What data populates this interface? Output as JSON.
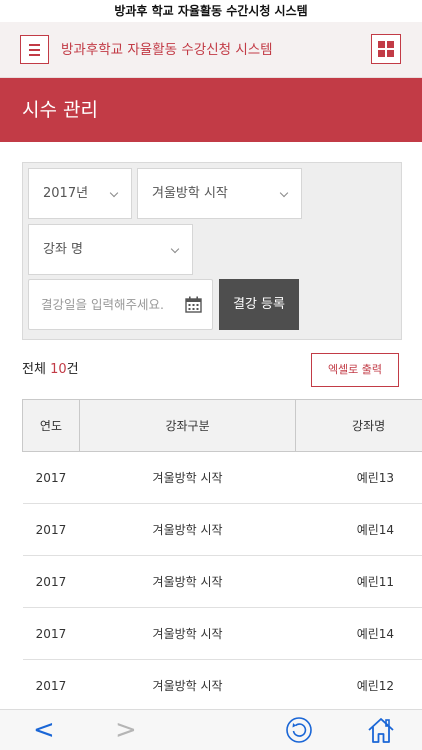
{
  "window": {
    "title": "방과후 학교 자율활동 수간시청 시스템"
  },
  "header": {
    "app_title": "방과후학교 자율활동 수강신청 시스템",
    "menu_icon": "hamburger-icon",
    "apps_icon": "grid-icon"
  },
  "page": {
    "heading": "시수 관리"
  },
  "filters": {
    "year": "2017년",
    "type": "겨울방학 시작",
    "course": "강좌 명",
    "date_placeholder": "결강일을 입력해주세요.",
    "register_label": "결강 등록"
  },
  "summary": {
    "prefix": "전체 ",
    "count": "10",
    "suffix": "건",
    "excel_label": "엑셀로 출력"
  },
  "table": {
    "headers": [
      "연도",
      "강좌구분",
      "강좌명"
    ],
    "rows": [
      [
        "2017",
        "겨울방학 시작",
        "예린13"
      ],
      [
        "2017",
        "겨울방학 시작",
        "예린14"
      ],
      [
        "2017",
        "겨울방학 시작",
        "예린11"
      ],
      [
        "2017",
        "겨울방학 시작",
        "예린14"
      ],
      [
        "2017",
        "겨울방학 시작",
        "예린12"
      ]
    ]
  },
  "nav": {
    "back": "<",
    "forward": ">",
    "refresh_icon": "refresh-icon",
    "home_icon": "home-icon"
  },
  "colors": {
    "accent": "#c23b46",
    "button_dark": "#4e4e4e",
    "link_blue": "#1a66d6"
  }
}
